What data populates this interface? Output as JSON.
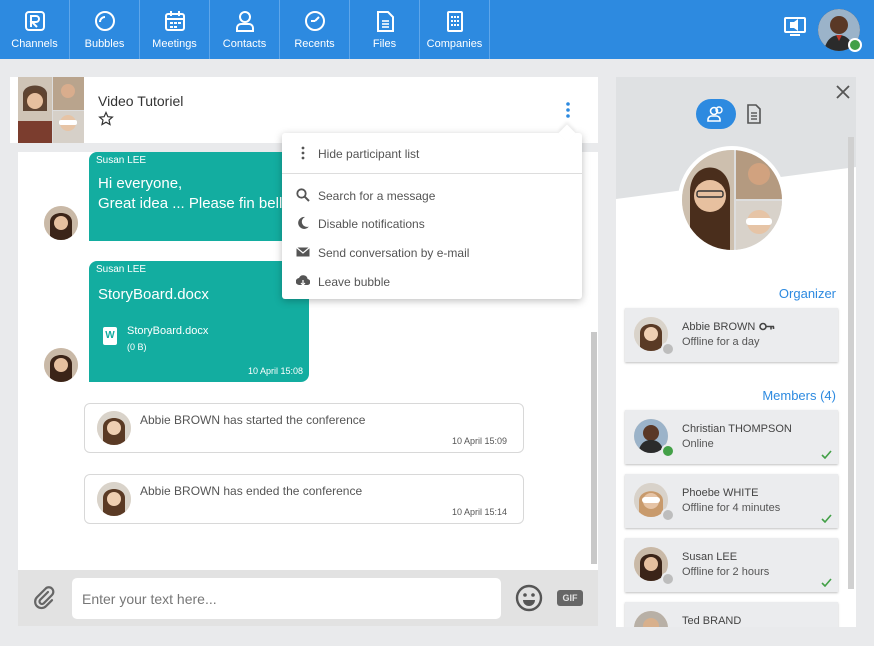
{
  "colors": {
    "brand_blue": "#2d8ae0",
    "bubble_teal": "#13ada0",
    "online_green": "#43a047",
    "offline_gray": "#bdbdbd"
  },
  "topbar": {
    "nav": [
      {
        "label": "Channels",
        "icon": "channels-icon"
      },
      {
        "label": "Bubbles",
        "icon": "bubbles-icon"
      },
      {
        "label": "Meetings",
        "icon": "meetings-icon"
      },
      {
        "label": "Contacts",
        "icon": "contacts-icon"
      },
      {
        "label": "Recents",
        "icon": "recents-icon"
      },
      {
        "label": "Files",
        "icon": "files-icon"
      },
      {
        "label": "Companies",
        "icon": "companies-icon"
      }
    ],
    "user_status": "online"
  },
  "conversation": {
    "title": "Video Tutoriel",
    "messages": [
      {
        "sender": "Susan LEE",
        "lines": [
          "Hi everyone,",
          "Great idea ... Please fin bello"
        ]
      },
      {
        "sender": "Susan LEE",
        "text": "StoryBoard.docx",
        "file_name": "StoryBoard.docx",
        "file_size": "(0 B)",
        "file_type_letter": "W",
        "time": "10 April 15:08"
      }
    ],
    "events": [
      {
        "text": "Abbie BROWN has started the conference",
        "time": "10 April 15:09"
      },
      {
        "text": "Abbie BROWN has ended the conference",
        "time": "10 April 15:14"
      }
    ],
    "input_placeholder": "Enter your text here...",
    "gif_label": "GIF"
  },
  "menu": {
    "items": [
      {
        "label": "Hide participant list",
        "icon": "more-vertical-icon"
      },
      {
        "label": "Search for a message",
        "icon": "search-icon"
      },
      {
        "label": "Disable notifications",
        "icon": "moon-icon"
      },
      {
        "label": "Send conversation by e-mail",
        "icon": "envelope-icon"
      },
      {
        "label": "Leave bubble",
        "icon": "leave-icon"
      }
    ]
  },
  "side": {
    "organizer_title": "Organizer",
    "organizer": {
      "name": "Abbie BROWN",
      "status": "Offline for a day",
      "presence": "offline"
    },
    "members_title": "Members (4)",
    "members": [
      {
        "name": "Christian THOMPSON",
        "status": "Online",
        "presence": "online"
      },
      {
        "name": "Phoebe WHITE",
        "status": "Offline for 4 minutes",
        "presence": "offline"
      },
      {
        "name": "Susan LEE",
        "status": "Offline for 2 hours",
        "presence": "offline"
      },
      {
        "name": "Ted BRAND",
        "status": "",
        "presence": "offline"
      }
    ]
  }
}
